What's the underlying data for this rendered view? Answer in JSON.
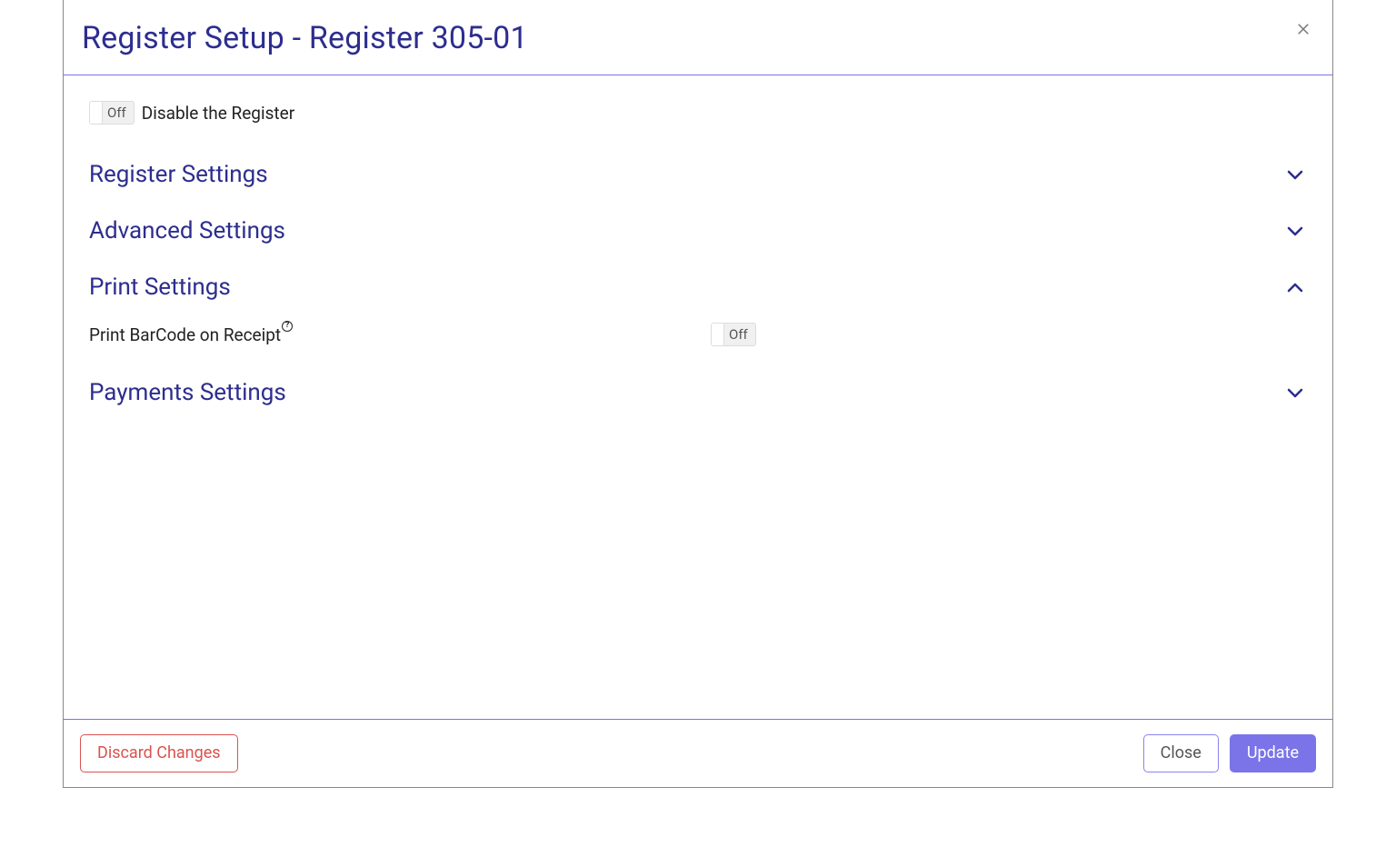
{
  "header": {
    "title": "Register Setup - Register 305-01"
  },
  "disable": {
    "toggle_state": "Off",
    "label": "Disable the Register"
  },
  "sections": {
    "register": {
      "title": "Register Settings",
      "expanded": false
    },
    "advanced": {
      "title": "Advanced Settings",
      "expanded": false
    },
    "print": {
      "title": "Print Settings",
      "expanded": true,
      "barcode_label": "Print BarCode on Receipt",
      "barcode_toggle": "Off"
    },
    "payments": {
      "title": "Payments Settings",
      "expanded": false
    }
  },
  "footer": {
    "discard": "Discard Changes",
    "close": "Close",
    "update": "Update"
  }
}
